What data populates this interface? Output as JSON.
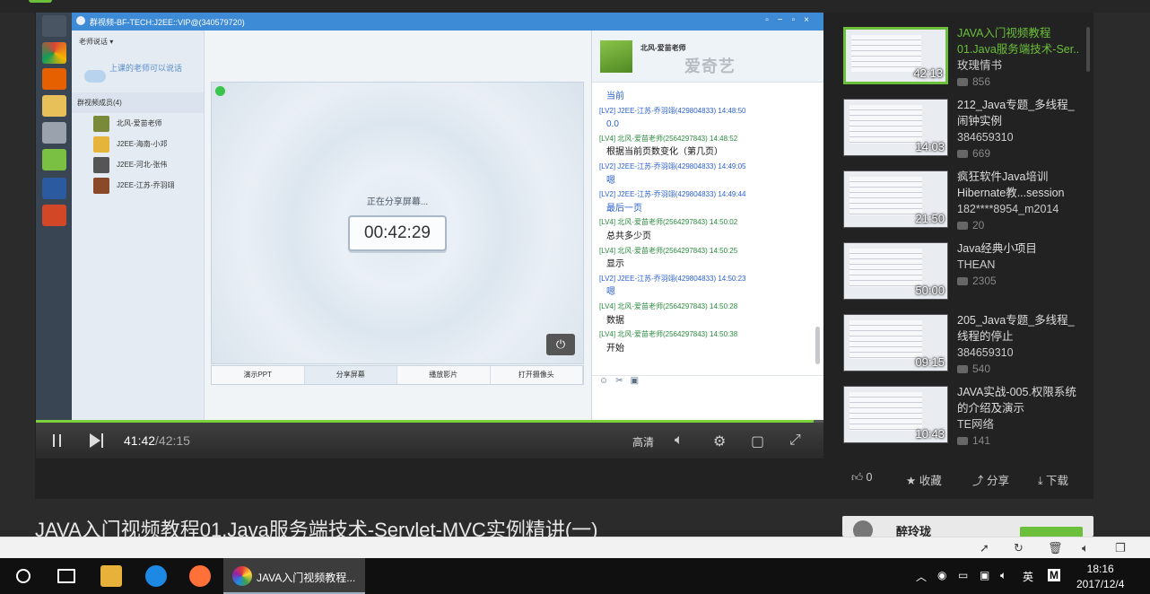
{
  "qq": {
    "window_title": "群视频-BF-TECH:J2EE::VIP@(340579720)",
    "speaker_mode": "老师说话",
    "tip": "上课的老师可以说话",
    "group_header": "群视频成员(4)",
    "members": [
      {
        "name": "北风-爱苗老师",
        "color": "#7a8a3a"
      },
      {
        "name": "J2EE-海南-小邓",
        "color": "#e5b53b"
      },
      {
        "name": "J2EE-河北-张伟",
        "color": "#555"
      },
      {
        "name": "J2EE-江苏-乔羽翊",
        "color": "#8a4a2a"
      }
    ],
    "sharing_label": "正在分享屏幕...",
    "timer": "00:42:29",
    "tools": [
      "演示PPT",
      "分享屏幕",
      "播放影片",
      "打开摄像头"
    ],
    "chat_name": "北风-爱苗老师",
    "watermark": "爱奇艺",
    "messages": [
      {
        "meta": "",
        "text": "当前",
        "blue": true
      },
      {
        "meta": "[LV2] J2EE-江苏-乔羽翊(429804833)  14:48:50",
        "text": "0.0",
        "blue": true
      },
      {
        "meta": "[LV4] 北风-爱苗老师(2564297843)  14:48:52",
        "text": "根据当前页数变化（第几页）",
        "blue": false
      },
      {
        "meta": "[LV2] J2EE-江苏-乔羽翊(429804833)  14:49:05",
        "text": "嗯",
        "blue": true
      },
      {
        "meta": "[LV2] J2EE-江苏-乔羽翊(429804833)  14:49:44",
        "text": "最后一页",
        "blue": true
      },
      {
        "meta": "[LV4] 北风-爱苗老师(2564297843)  14:50:02",
        "text": "总共多少页",
        "blue": false
      },
      {
        "meta": "[LV4] 北风-爱苗老师(2564297843)  14:50:25",
        "text": "显示",
        "blue": false
      },
      {
        "meta": "[LV2] J2EE-江苏-乔羽翊(429804833)  14:50:23",
        "text": "嗯",
        "blue": true
      },
      {
        "meta": "[LV4] 北风-爱苗老师(2564297843)  14:50:28",
        "text": "数据",
        "blue": false
      },
      {
        "meta": "[LV4] 北风-爱苗老师(2564297843)  14:50:38",
        "text": "开始",
        "blue": false
      }
    ]
  },
  "player": {
    "current_time": "41:42",
    "total_time": "/42:15",
    "progress": 0.988,
    "quality": "高清"
  },
  "playlist": [
    {
      "title": "JAVA入门视频教程01.Java服务端技术-Ser..",
      "author": "玫瑰情书",
      "views": "856",
      "duration": "42:13",
      "active": true
    },
    {
      "title": "212_Java专题_多线程_闹钟实例",
      "author": "384659310",
      "views": "669",
      "duration": "14:03",
      "active": false
    },
    {
      "title": "疯狂软件Java培训Hibernate教...session",
      "author": "182****8954_m2014",
      "views": "20",
      "duration": "21:50",
      "active": false
    },
    {
      "title": "Java经典小项目",
      "author": "THEAN",
      "views": "2305",
      "duration": "50:00",
      "active": false
    },
    {
      "title": "205_Java专题_多线程_线程的停止",
      "author": "384659310",
      "views": "540",
      "duration": "09:15",
      "active": false
    },
    {
      "title": "JAVA实战-005.权限系统的介绍及演示",
      "author": "TE网络",
      "views": "141",
      "duration": "10:43",
      "active": false
    }
  ],
  "actions": {
    "likes": "0",
    "collect": "收藏",
    "share": "分享",
    "download": "下载"
  },
  "video_title": "JAVA入门视频教程01.Java服务端技术-Servlet-MVC实例精讲(一)",
  "uploader": {
    "name": "醉玲珑"
  },
  "taskbar": {
    "active_app": "JAVA入门视频教程...",
    "ime": "英",
    "time": "18:16",
    "date": "2017/12/4"
  }
}
